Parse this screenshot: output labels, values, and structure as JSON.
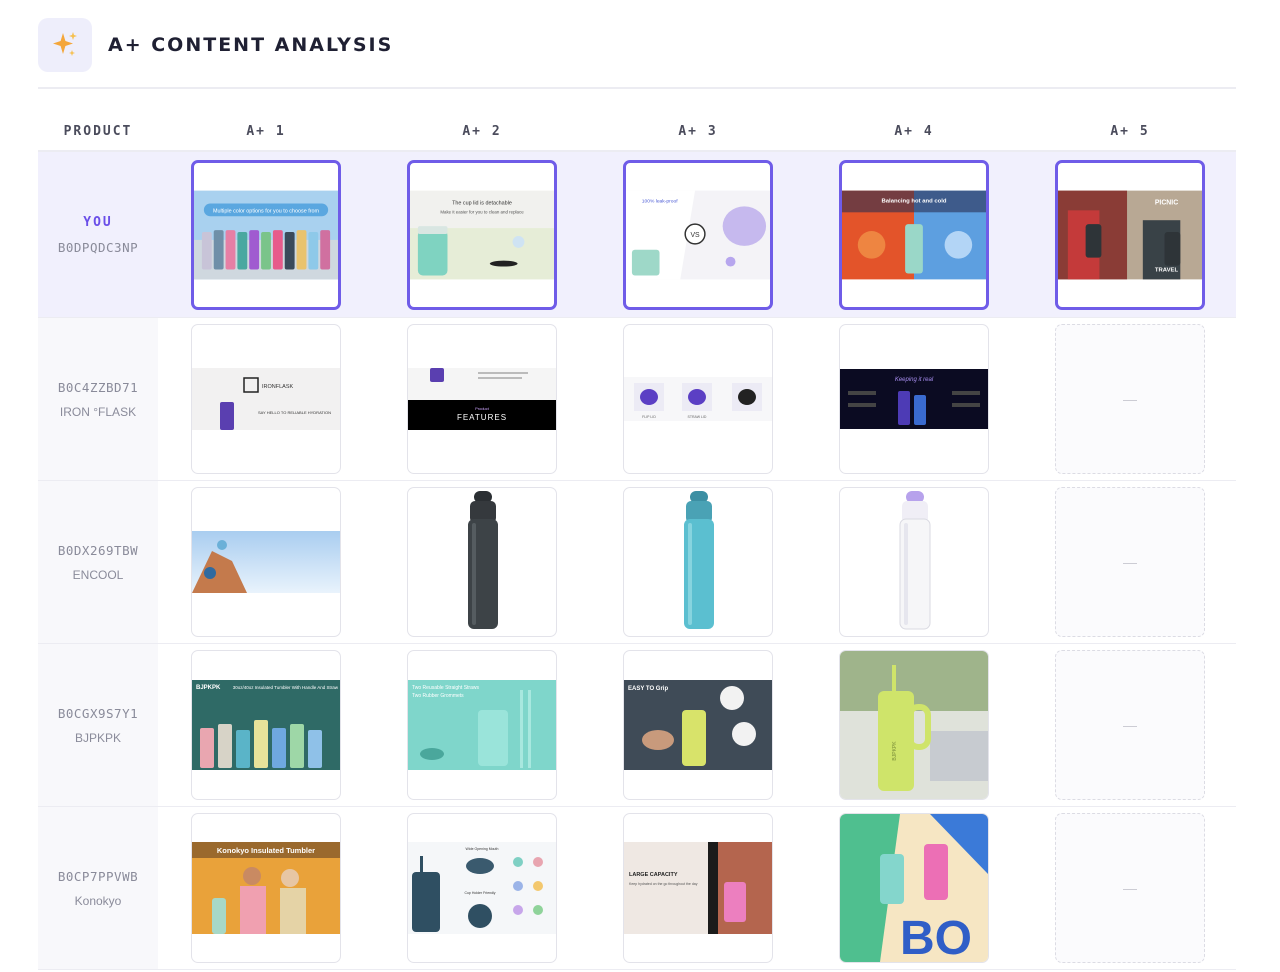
{
  "header": {
    "title": "A+ CONTENT ANALYSIS",
    "icon": "sparkles-icon",
    "accent": "#6f5ce8"
  },
  "columns": [
    "PRODUCT",
    "A+ 1",
    "A+ 2",
    "A+ 3",
    "A+ 4",
    "A+ 5"
  ],
  "you_row": {
    "label": "YOU",
    "asin": "B0DPQDC3NP",
    "modules": [
      {
        "text": "Multiple color options for you to choose from"
      },
      {
        "text": "The cup lid is detachable",
        "text2": "Make it easier for you to clean and replace"
      },
      {
        "text": "100% leak-proof",
        "text2": "VS"
      },
      {
        "text": "Balancing hot and cold"
      },
      {
        "text": "PICNIC",
        "text2": "TRAVEL"
      }
    ]
  },
  "competitors": [
    {
      "asin": "B0C4ZZBD71",
      "brand": "IRON °FLASK",
      "modules": [
        {
          "text": "IRONFLASK",
          "text2": "SAY HELLO TO RELIABLE HYDRATION"
        },
        {
          "text": "FEATURES",
          "text2": "Product"
        },
        {
          "text": "FLIP LID",
          "text2": "STRAW LID"
        },
        {
          "text": "Keeping it real"
        },
        null
      ]
    },
    {
      "asin": "B0DX269TBW",
      "brand": "ENCOOL",
      "modules": [
        {},
        {},
        {},
        {},
        null
      ]
    },
    {
      "asin": "B0CGX9S7Y1",
      "brand": "BJPKPK",
      "modules": [
        {
          "text": "BJPKPK",
          "text2": "30oz/40oz Insulated Tumbler With Handle And Straw"
        },
        {
          "text": "Two Reusable Straight Straws",
          "text2": "Two Rubber Grommets"
        },
        {
          "text": "EASY TO Grip"
        },
        {
          "text": "BJPKPK"
        },
        null
      ]
    },
    {
      "asin": "B0CP7PPVWB",
      "brand": "Konokyo",
      "modules": [
        {
          "text": "Konokyo Insulated Tumbler"
        },
        {
          "text": "Wide Opening Mouth",
          "text2": "Cup Holder Friendly"
        },
        {
          "text": "LARGE CAPACITY",
          "text2": "Keep hydrated on the go throughout the day"
        },
        {
          "text": "BO"
        },
        null
      ]
    }
  ],
  "empty_placeholder": "—"
}
